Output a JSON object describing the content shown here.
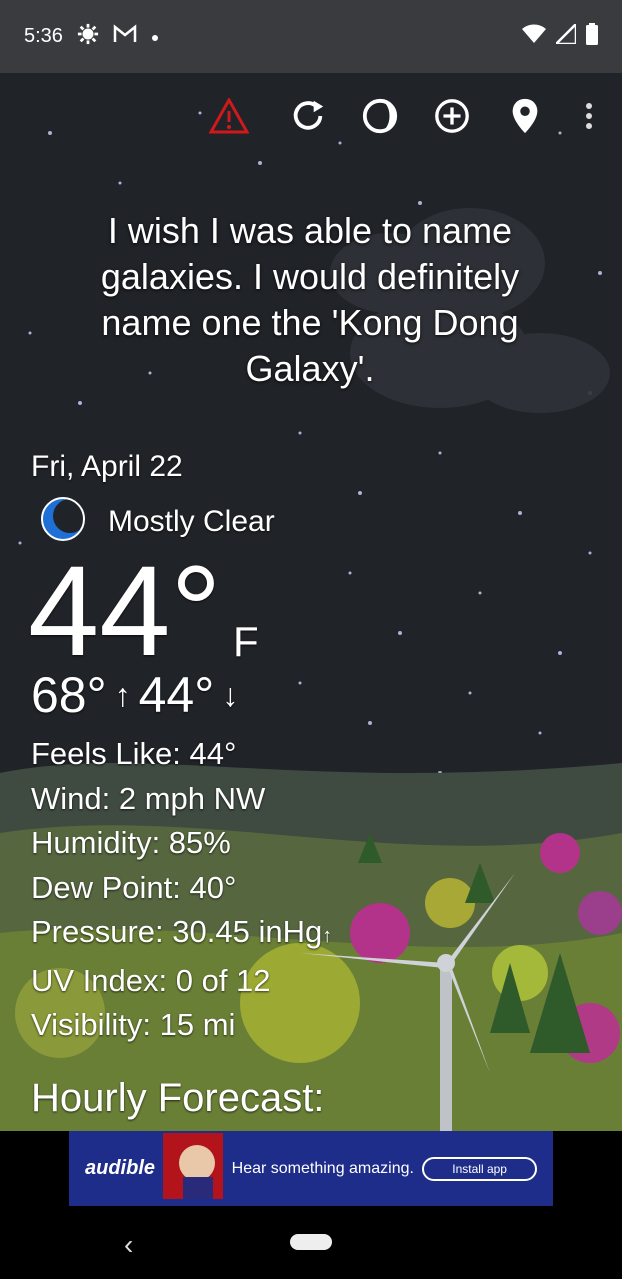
{
  "status_bar": {
    "time": "5:36",
    "icons": [
      "settings-icon",
      "gmail-icon",
      "notification-dot-icon",
      "wifi-icon",
      "signal-icon",
      "battery-icon"
    ]
  },
  "toolbar": {
    "icons": [
      "warning-icon",
      "refresh-icon",
      "theme-icon",
      "add-location-icon",
      "location-pin-icon",
      "more-vert-icon"
    ],
    "warning_color": "#d0191b"
  },
  "quote": "I wish I was able to name galaxies. I would definitely name one the 'Kong Dong Galaxy'.",
  "weather": {
    "date": "Fri, April 22",
    "condition": "Mostly Clear",
    "condition_icon": "moon-icon",
    "temperature": "44°",
    "unit": "F",
    "high": "68°",
    "low": "44°",
    "feels_like": "Feels Like:  44°",
    "wind": "Wind:  2 mph NW",
    "humidity": "Humidity:  85%",
    "dew_point": "Dew Point:  40°",
    "pressure": "Pressure:  30.45 inHg",
    "uv_index": "UV Index:  0 of 12",
    "visibility": "Visibility:  15 mi"
  },
  "hourly_title": "Hourly Forecast:",
  "ad": {
    "brand": "audible",
    "text": "Hear something amazing.",
    "cta": "Install app",
    "accent": "#1e2c8a"
  },
  "nav": {
    "back": "‹"
  }
}
